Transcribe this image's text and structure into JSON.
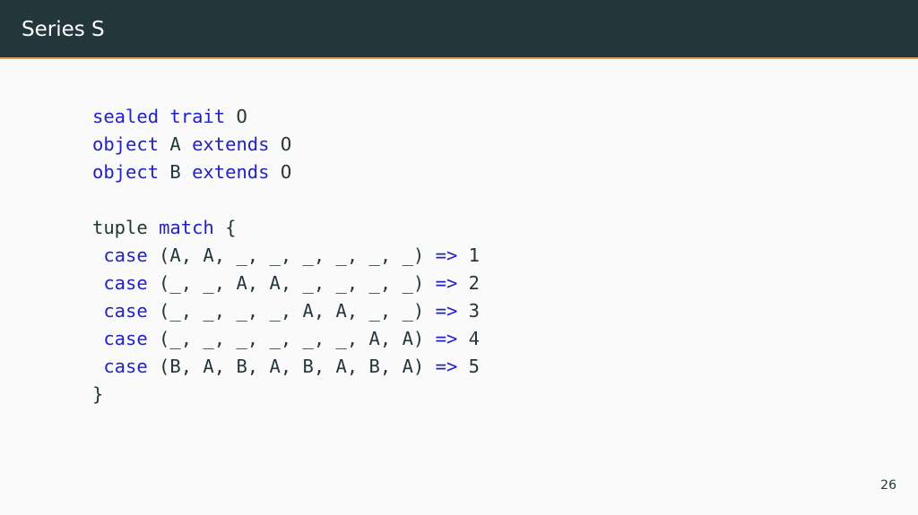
{
  "header": {
    "title": "Series S"
  },
  "colors": {
    "header_bg": "#23373b",
    "header_rule": "#e4a05b",
    "background": "#fafafa",
    "keyword": "#2121c4",
    "text": "#23373b"
  },
  "code": {
    "lines": [
      [
        {
          "t": "sealed trait",
          "k": 1
        },
        {
          "t": " O",
          "k": 0
        }
      ],
      [
        {
          "t": "object",
          "k": 1
        },
        {
          "t": " A ",
          "k": 0
        },
        {
          "t": "extends",
          "k": 1
        },
        {
          "t": " O",
          "k": 0
        }
      ],
      [
        {
          "t": "object",
          "k": 1
        },
        {
          "t": " B ",
          "k": 0
        },
        {
          "t": "extends",
          "k": 1
        },
        {
          "t": " O",
          "k": 0
        }
      ],
      [],
      [
        {
          "t": "tuple ",
          "k": 0
        },
        {
          "t": "match",
          "k": 1
        },
        {
          "t": " {",
          "k": 0
        }
      ],
      [
        {
          "t": " ",
          "k": 0
        },
        {
          "t": "case",
          "k": 1
        },
        {
          "t": " (A, A, _, _, _, _, _, _) ",
          "k": 0
        },
        {
          "t": "=>",
          "k": 1
        },
        {
          "t": " 1",
          "k": 0
        }
      ],
      [
        {
          "t": " ",
          "k": 0
        },
        {
          "t": "case",
          "k": 1
        },
        {
          "t": " (_, _, A, A, _, _, _, _) ",
          "k": 0
        },
        {
          "t": "=>",
          "k": 1
        },
        {
          "t": " 2",
          "k": 0
        }
      ],
      [
        {
          "t": " ",
          "k": 0
        },
        {
          "t": "case",
          "k": 1
        },
        {
          "t": " (_, _, _, _, A, A, _, _) ",
          "k": 0
        },
        {
          "t": "=>",
          "k": 1
        },
        {
          "t": " 3",
          "k": 0
        }
      ],
      [
        {
          "t": " ",
          "k": 0
        },
        {
          "t": "case",
          "k": 1
        },
        {
          "t": " (_, _, _, _, _, _, A, A) ",
          "k": 0
        },
        {
          "t": "=>",
          "k": 1
        },
        {
          "t": " 4",
          "k": 0
        }
      ],
      [
        {
          "t": " ",
          "k": 0
        },
        {
          "t": "case",
          "k": 1
        },
        {
          "t": " (B, A, B, A, B, A, B, A) ",
          "k": 0
        },
        {
          "t": "=>",
          "k": 1
        },
        {
          "t": " 5",
          "k": 0
        }
      ],
      [
        {
          "t": "}",
          "k": 0
        }
      ]
    ]
  },
  "footer": {
    "page_number": "26"
  }
}
